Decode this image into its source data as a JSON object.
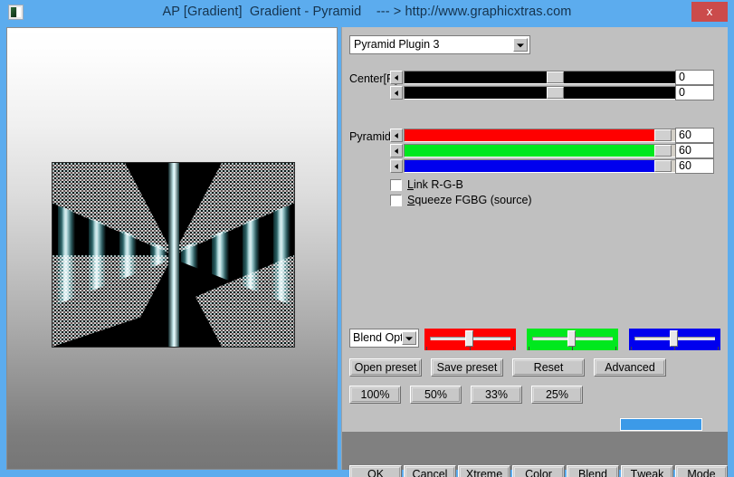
{
  "window": {
    "title": "AP [Gradient]  Gradient - Pyramid    --- > http://www.graphicxtras.com",
    "close_label": "x",
    "app_icon": "image-thumbnail-icon",
    "titlebar_color": "#5cacee",
    "close_button_color": "#cb4b4b",
    "panel_color": "#c0c0c0"
  },
  "preview": {
    "zoom_percent": "33%",
    "description": "pyramid gradient render preview"
  },
  "plugin_select": {
    "value": "Pyramid Plugin 3",
    "arrow_icon": "chevron-down-icon"
  },
  "center": {
    "label": "Center[R]:",
    "rows": [
      {
        "value": "0",
        "thumb_percent": 51
      },
      {
        "value": "0",
        "thumb_percent": 51
      }
    ],
    "left_arrow_icon": "arrow-left-icon",
    "right_arrow_icon": "arrow-right-icon"
  },
  "pyramid": {
    "label": "Pyramid:",
    "rows": [
      {
        "channel": "R",
        "value": "60",
        "color": "#ff0000",
        "fill_percent": 88
      },
      {
        "channel": "G",
        "value": "60",
        "color": "#00e81e",
        "fill_percent": 88
      },
      {
        "channel": "B",
        "value": "60",
        "color": "#0000ee",
        "fill_percent": 88
      }
    ]
  },
  "checkboxes": [
    {
      "label_pre": "L",
      "label_post": "ink R-G-B",
      "checked": false
    },
    {
      "label_pre": "S",
      "label_post": "queeze FGBG (source)",
      "checked": false
    }
  ],
  "blend": {
    "dropdown_value": "Blend Opti",
    "arrow_icon": "chevron-down-icon",
    "sliders": [
      {
        "name": "red-blend",
        "color": "#ff0000",
        "thumb_percent": 49
      },
      {
        "name": "green-blend",
        "color": "#00e81e",
        "thumb_percent": 49
      },
      {
        "name": "blue-blend",
        "color": "#0000ee",
        "thumb_percent": 49
      }
    ]
  },
  "preset_buttons": [
    {
      "label": "Open preset"
    },
    {
      "label": "Save preset"
    },
    {
      "label": "Reset"
    },
    {
      "label": "Advanced"
    }
  ],
  "zoom_buttons": [
    {
      "label": "100%"
    },
    {
      "label": "50%"
    },
    {
      "label": "33%"
    },
    {
      "label": "25%"
    }
  ],
  "zoom_stepper": {
    "plus_label": "+",
    "value": "33%",
    "minus_label": "–"
  },
  "color_swatch": {
    "color": "#3c9ae8"
  },
  "footer_buttons": [
    {
      "pre": "",
      "hot": "O",
      "post": "K"
    },
    {
      "pre": "C",
      "hot": "a",
      "post": "ncel"
    },
    {
      "pre": "",
      "hot": "X",
      "post": "treme"
    },
    {
      "pre": "",
      "hot": "C",
      "post": "olor"
    },
    {
      "pre": "",
      "hot": "B",
      "post": "lend"
    },
    {
      "pre": "",
      "hot": "T",
      "post": "weak"
    },
    {
      "pre": "",
      "hot": "M",
      "post": "ode"
    }
  ]
}
